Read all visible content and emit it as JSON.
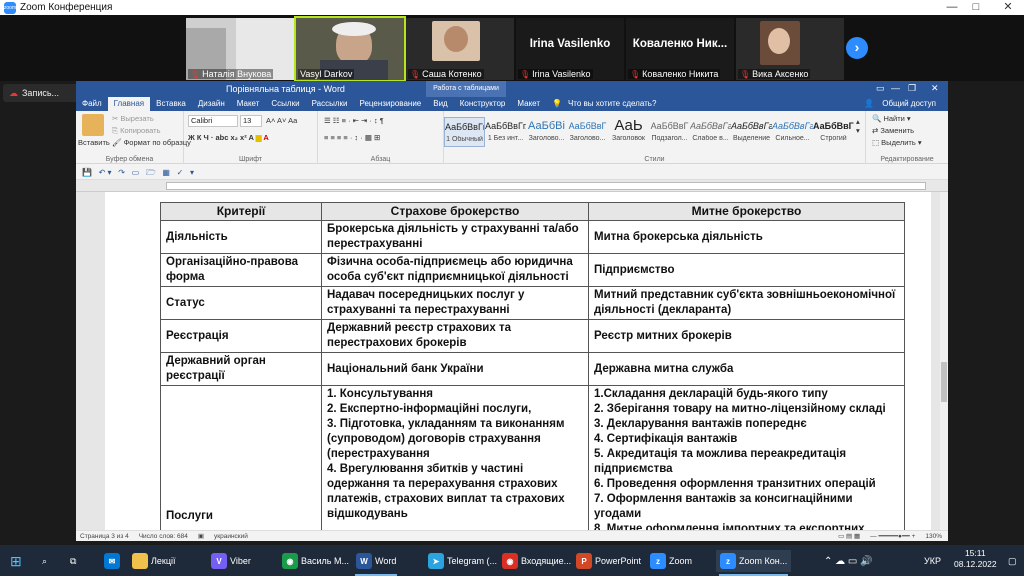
{
  "zoom": {
    "title": "Zoom Конференция",
    "participants": [
      {
        "name": "Наталія Внукова",
        "muted": true,
        "has_video": true
      },
      {
        "name": "Vasyl Darkov",
        "muted": false,
        "has_video": true
      },
      {
        "name": "Саша Котенко",
        "muted": true,
        "has_video": true
      },
      {
        "name": "Irina Vasilenko",
        "muted": true,
        "has_video": false
      },
      {
        "name": "Коваленко Никита",
        "muted": true,
        "has_video": false,
        "big_label": "Коваленко Ник..."
      },
      {
        "name": "Вика Аксенко",
        "muted": true,
        "has_video": true
      }
    ],
    "record_label": "Запись..."
  },
  "word": {
    "title": "Порівняльна таблиця - Word",
    "context_title": "Работа с таблицами",
    "tabs": [
      "Файл",
      "Главная",
      "Вставка",
      "Дизайн",
      "Макет",
      "Ссылки",
      "Рассылки",
      "Рецензирование",
      "Вид",
      "Конструктор",
      "Макет"
    ],
    "tell_me": "Что вы хотите сделать?",
    "share": "Общий доступ",
    "clipboard": {
      "paste": "Вставить",
      "cut": "Вырезать",
      "copy": "Копировать",
      "format": "Формат по образцу",
      "label": "Буфер обмена"
    },
    "font": {
      "name": "Calibri",
      "size": "13",
      "label": "Шрифт"
    },
    "paragraph_label": "Абзац",
    "styles_label": "Стили",
    "styles": [
      {
        "sample": "АаБбВвГг,",
        "name": "1 Обычный"
      },
      {
        "sample": "АаБбВвГг,",
        "name": "1 Без инт..."
      },
      {
        "sample": "АаБбВі",
        "name": "Заголово..."
      },
      {
        "sample": "АаБбВвГ",
        "name": "Заголово..."
      },
      {
        "sample": "АаЬ",
        "name": "Заголовок"
      },
      {
        "sample": "АаБбВвГ",
        "name": "Подзагол..."
      },
      {
        "sample": "АаБбВвГг,",
        "name": "Слабое в..."
      },
      {
        "sample": "АаБбВвГг,",
        "name": "Выделение"
      },
      {
        "sample": "АаБбВвГг,",
        "name": "Сильное..."
      },
      {
        "sample": "АаБбВвГг,",
        "name": "Строгий"
      }
    ],
    "editing": {
      "find": "Найти",
      "replace": "Заменить",
      "select": "Выделить",
      "label": "Редактирование"
    },
    "status": {
      "page": "Страница 3 из 4",
      "words": "Число слов: 684",
      "lang": "украинский",
      "zoom": "130%"
    }
  },
  "table": {
    "headers": [
      "Критерії",
      "Страхове брокерство",
      "Митне брокерство"
    ],
    "rows": [
      {
        "criterion": "Діяльність",
        "insurance": "Брокерська діяльність у страхуванні та/або перестрахуванні",
        "customs": "Митна брокерська діяльність"
      },
      {
        "criterion": "Організаційно-правова форма",
        "insurance": "Фізична особа-підприємець або юридична особа суб'єкт підприємницької діяльності",
        "customs": "Підприємство"
      },
      {
        "criterion": "Статус",
        "insurance": "Надавач посередницьких послуг у страхуванні та перестрахуванні",
        "customs": "Митний представник суб'єкта зовнішньоекономічної діяльності (декларанта)"
      },
      {
        "criterion": "Реєстрація",
        "insurance": "Державний реєстр страхових та перестрахових брокерів",
        "customs": "Реєстр митних брокерів"
      },
      {
        "criterion": "Державний орган реєстрації",
        "insurance": "Національний банк України",
        "customs": "Державна митна служба"
      }
    ],
    "services": {
      "criterion": "Послуги",
      "insurance": [
        "1. Консультування",
        "2. Експертно-інформаційні послуги,",
        "3. Підготовка, укладанням та виконанням (супроводом) договорів страхування (перестрахування",
        "4. Врегулювання збитків у частині одержання та перерахування страхових платежів, страхових виплат та страхових відшкодувань"
      ],
      "customs": [
        "1.Складання декларацій будь-якого типу",
        "2. Зберігання товару на митно-ліцензійному складі",
        "3. Декларування вантажів попереднє",
        "4. Сертифікація вантажів",
        "5. Акредитація та можлива переакредитація підприємства",
        "6. Проведення оформлення транзитних операцій",
        "7. Оформлення вантажів за консигнаційними угодами",
        "8. Митне оформлення імпортних та експортних"
      ]
    }
  },
  "taskbar": {
    "items": [
      {
        "label": "Лекції",
        "color": "#f0c14b"
      },
      {
        "label": "Viber",
        "color": "#7360f2"
      },
      {
        "label": "Василь М...",
        "color": "#1a9b4b"
      },
      {
        "label": "Word",
        "color": "#2b579a"
      },
      {
        "label": "Telegram (...",
        "color": "#2aa3df"
      },
      {
        "label": "Входящие...",
        "color": "#d93025"
      },
      {
        "label": "PowerPoint",
        "color": "#d24726"
      },
      {
        "label": "Zoom",
        "color": "#2d8cff"
      },
      {
        "label": "Zoom Кон...",
        "color": "#2d8cff"
      }
    ],
    "lang": "УКР",
    "time": "15:11",
    "date": "08.12.2022"
  }
}
